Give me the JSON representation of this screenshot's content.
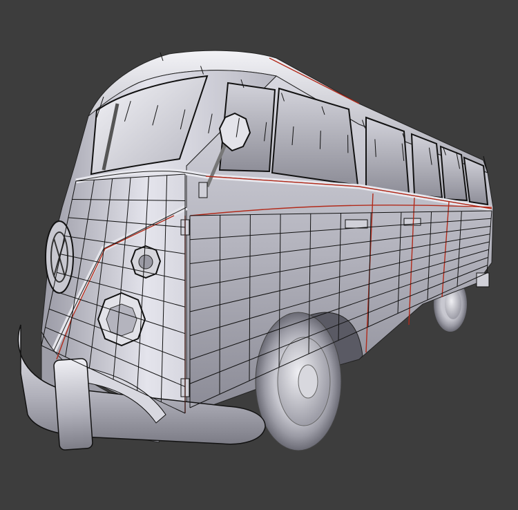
{
  "viewport": {
    "background": "#3d3d3d",
    "view_mode": "solid-with-wireframe-overlay",
    "subject": "van-mesh"
  },
  "colors": {
    "body_light": "#e6e6ee",
    "body_mid": "#a9a9b4",
    "body_dark": "#6e6e78",
    "wire": "#111111",
    "seam": "#b22a1a"
  }
}
